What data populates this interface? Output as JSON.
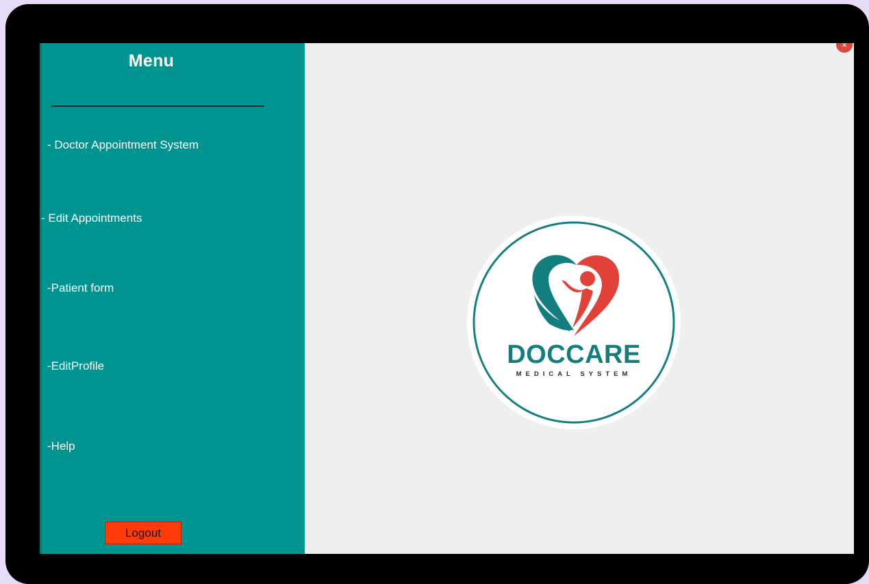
{
  "sidebar": {
    "title": "Menu",
    "items": [
      {
        "label": "- Doctor Appointment System"
      },
      {
        "label": "- Edit Appointments"
      },
      {
        "label": "-Patient form"
      },
      {
        "label": "-EditProfile"
      },
      {
        "label": "-Help"
      }
    ],
    "logout_label": "Logout"
  },
  "logo": {
    "brand": "DOCCARE",
    "tagline": "MEDICAL SYSTEM"
  },
  "window": {
    "close_glyph": "×"
  },
  "colors": {
    "sidebar_bg": "#009490",
    "content_bg": "#efefef",
    "logout_bg": "#ff3b0a",
    "brand_teal": "#127f7e",
    "brand_red": "#e0423a"
  },
  "icons": [
    "close-icon",
    "doccare-logo"
  ]
}
